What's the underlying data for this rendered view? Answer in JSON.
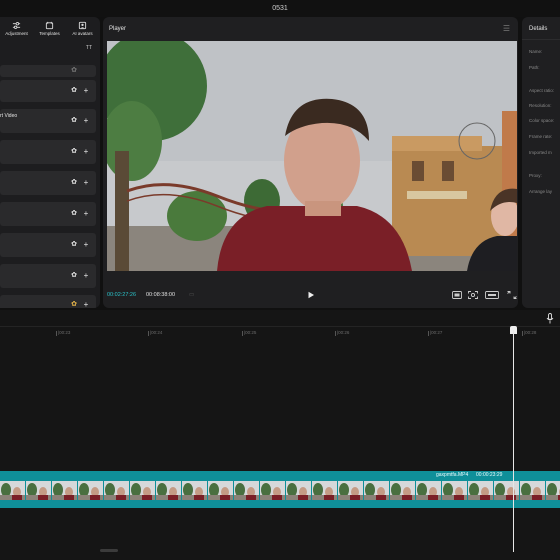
{
  "app": {
    "title": "0531"
  },
  "left_panel": {
    "tabs": [
      {
        "label": "Adjustment",
        "icon": "sliders-icon"
      },
      {
        "label": "Templates",
        "icon": "templates-icon"
      },
      {
        "label": "AI avatars",
        "icon": "avatar-icon"
      }
    ],
    "filter_label": "TT",
    "items": [
      {
        "label": ""
      },
      {
        "label": ""
      },
      {
        "label": "rt Video"
      },
      {
        "label": ""
      },
      {
        "label": ""
      },
      {
        "label": ""
      },
      {
        "label": ""
      },
      {
        "label": ""
      },
      {
        "label": ""
      }
    ]
  },
  "player": {
    "title": "Player",
    "current_time": "00:02:27:26",
    "total_time": "00:08:38:00"
  },
  "details": {
    "title": "Details",
    "fields": [
      "Name:",
      "Path:",
      "Aspect ratio:",
      "Resolution:",
      "Color space:",
      "Frame rate:",
      "Imported m",
      "Proxy:",
      "Arrange lay"
    ]
  },
  "timeline": {
    "ruler_ticks": [
      "|00:23",
      "|00:24",
      "|00:25",
      "|00:26",
      "|00:27",
      "|00:28"
    ],
    "clip": {
      "name": "gaxpmtfa.MP4",
      "duration": "00:00:23:29"
    }
  },
  "colors": {
    "accent": "#2bc2c9",
    "track": "#0f8f99"
  }
}
